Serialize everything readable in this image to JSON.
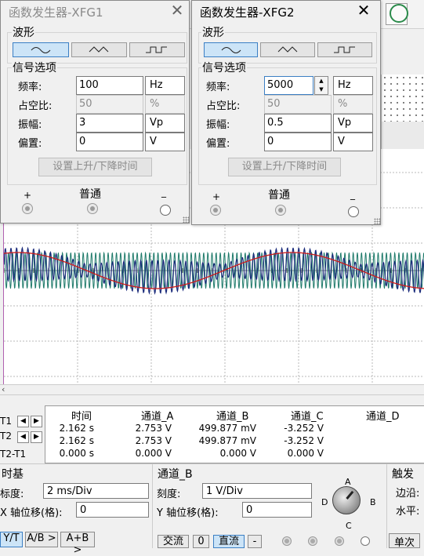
{
  "colors": {
    "channel_a": "#cc1b1b",
    "channel_b": "#1a2a7a",
    "channel_b_alt": "#1e7a6a",
    "selected": "#cce4f7"
  },
  "scope": {
    "cursor_labels": [
      "T1",
      "T2",
      "T2-T1"
    ],
    "table": {
      "headers": [
        "时间",
        "通道_A",
        "通道_B",
        "通道_C",
        "通道_D"
      ],
      "rows": [
        [
          "2.162 s",
          "2.753 V",
          "499.877 mV",
          "-3.252 V",
          ""
        ],
        [
          "2.162 s",
          "2.753 V",
          "499.877 mV",
          "-3.252 V",
          ""
        ],
        [
          "0.000 s",
          "0.000 V",
          "0.000 V",
          "0.000 V",
          ""
        ]
      ]
    },
    "timebase": {
      "title": "时基",
      "scale_label": "标度:",
      "scale_value": "2 ms/Div",
      "xpos_label": "X 轴位移(格):",
      "xpos_value": "0",
      "modes": [
        "Y/T",
        "A/B >",
        "A+B >"
      ]
    },
    "channel_b": {
      "title": "通道_B",
      "scale_label": "刻度:",
      "scale_value": "1  V/Div",
      "ypos_label": "Y 轴位移(格):",
      "ypos_value": "0",
      "coupling": [
        "交流",
        "0",
        "直流",
        "-"
      ]
    },
    "channel_selector": {
      "a": "A",
      "b": "B",
      "c": "C",
      "d": "D"
    },
    "trigger": {
      "title": "触发",
      "edge_label": "边沿:",
      "level_label": "水平:",
      "single_label": "单次"
    }
  },
  "xfg1": {
    "title": "函数发生器-XFG1",
    "waveform_group": "波形",
    "signal_group": "信号选项",
    "waveforms": [
      "sine-wave-icon",
      "triangle-wave-icon",
      "square-wave-icon"
    ],
    "selected_waveform": "sine",
    "fields": [
      {
        "label": "频率:",
        "value": "100",
        "unit": "Hz",
        "enabled": true
      },
      {
        "label": "占空比:",
        "value": "50",
        "unit": "%",
        "enabled": false
      },
      {
        "label": "振幅:",
        "value": "3",
        "unit": "Vp",
        "enabled": true
      },
      {
        "label": "偏置:",
        "value": "0",
        "unit": "V",
        "enabled": true
      }
    ],
    "rise_fall_button": "设置上升/下降时间",
    "terminals": {
      "plus": "+",
      "common": "普通",
      "minus": "_"
    }
  },
  "xfg2": {
    "title": "函数发生器-XFG2",
    "waveform_group": "波形",
    "signal_group": "信号选项",
    "waveforms": [
      "sine-wave-icon",
      "triangle-wave-icon",
      "square-wave-icon"
    ],
    "selected_waveform": "sine",
    "fields": [
      {
        "label": "频率:",
        "value": "5000",
        "unit": "Hz",
        "enabled": true
      },
      {
        "label": "占空比:",
        "value": "50",
        "unit": "%",
        "enabled": false
      },
      {
        "label": "振幅:",
        "value": "0.5",
        "unit": "Vp",
        "enabled": true
      },
      {
        "label": "偏置:",
        "value": "0",
        "unit": "V",
        "enabled": true
      }
    ],
    "rise_fall_button": "设置上升/下降时间",
    "terminals": {
      "plus": "+",
      "common": "普通",
      "minus": "_"
    }
  },
  "close_glyph": "✕"
}
